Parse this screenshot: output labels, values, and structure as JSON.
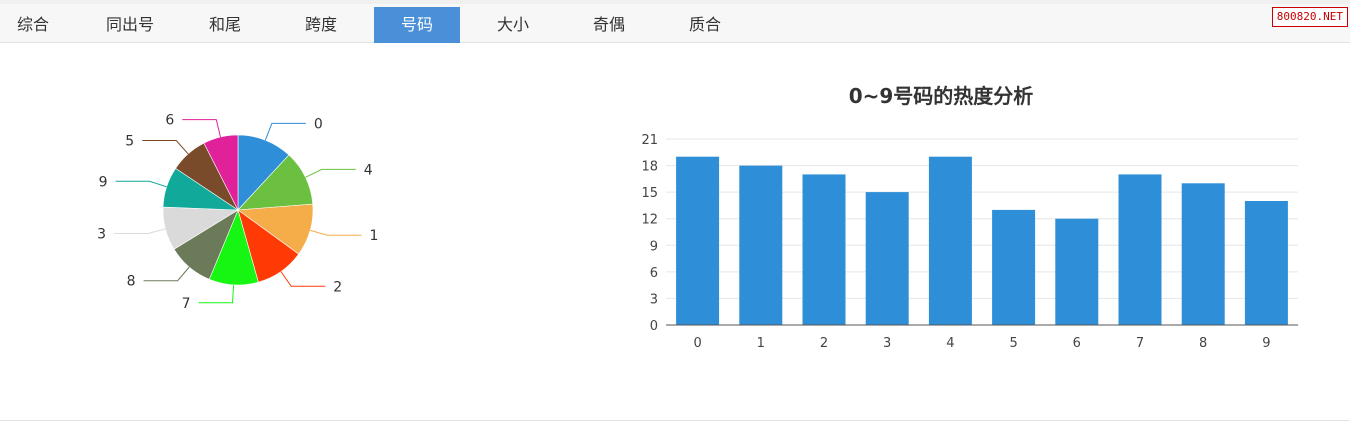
{
  "tabs": [
    {
      "label": "综合",
      "active": false
    },
    {
      "label": "同出号",
      "active": false
    },
    {
      "label": "和尾",
      "active": false
    },
    {
      "label": "跨度",
      "active": false
    },
    {
      "label": "号码",
      "active": true
    },
    {
      "label": "大小",
      "active": false
    },
    {
      "label": "奇偶",
      "active": false
    },
    {
      "label": "质合",
      "active": false
    }
  ],
  "watermark": "800820.NET",
  "colors": {
    "tab_active_bg": "#4a90d9",
    "bar": "#2e8fd8",
    "watermark": "#cc0000"
  },
  "chart_data": [
    {
      "type": "pie",
      "slices": [
        {
          "label": "0",
          "value": 19,
          "color": "#2e8fd8"
        },
        {
          "label": "4",
          "value": 19,
          "color": "#6cc03f"
        },
        {
          "label": "1",
          "value": 18,
          "color": "#f5ad4a"
        },
        {
          "label": "2",
          "value": 17,
          "color": "#ff3a05"
        },
        {
          "label": "7",
          "value": 17,
          "color": "#17f512"
        },
        {
          "label": "8",
          "value": 16,
          "color": "#6b7a58"
        },
        {
          "label": "3",
          "value": 15,
          "color": "#dadada"
        },
        {
          "label": "9",
          "value": 14,
          "color": "#10a99a"
        },
        {
          "label": "5",
          "value": 13,
          "color": "#7a4b2a"
        },
        {
          "label": "6",
          "value": 12,
          "color": "#e0219a"
        }
      ]
    },
    {
      "type": "bar",
      "title": "0~9号码的热度分析",
      "categories": [
        "0",
        "1",
        "2",
        "3",
        "4",
        "5",
        "6",
        "7",
        "8",
        "9"
      ],
      "values": [
        19,
        18,
        17,
        15,
        19,
        13,
        12,
        17,
        16,
        14
      ],
      "ylim": [
        0,
        21
      ],
      "yticks": [
        0,
        3,
        6,
        9,
        12,
        15,
        18,
        21
      ],
      "grid": true
    }
  ]
}
